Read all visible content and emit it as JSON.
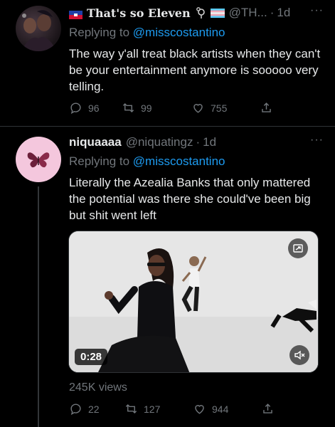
{
  "tweet1": {
    "display_name": "That's so Eleven",
    "handle": "@TH...",
    "time": "1d",
    "replying_prefix": "Replying to",
    "replying_to": "@misscostantino",
    "text": "The way y'all treat black artists when they can't be your entertainment anymore is sooooo very telling.",
    "replies": "96",
    "retweets": "99",
    "likes": "755"
  },
  "tweet2": {
    "display_name": "niquaaaa",
    "handle": "@niquatingz",
    "time": "1d",
    "replying_prefix": "Replying to",
    "replying_to": "@misscostantino",
    "text": "Literally the Azealia Banks that only mattered the potential was there she could've been big but shit went left",
    "video_duration": "0:28",
    "views": "245K views",
    "replies": "22",
    "retweets": "127",
    "likes": "944"
  },
  "colors": {
    "background": "#000000",
    "text": "#e7e9ea",
    "secondary": "#71767b",
    "link": "#1d9bf0"
  },
  "icons": [
    "haiti-flag-icon",
    "genderfluid-symbol-icon",
    "trans-flag-icon",
    "more-icon",
    "reply-icon",
    "retweet-icon",
    "like-icon",
    "share-icon",
    "butterfly-icon",
    "pip-icon",
    "mute-icon"
  ]
}
